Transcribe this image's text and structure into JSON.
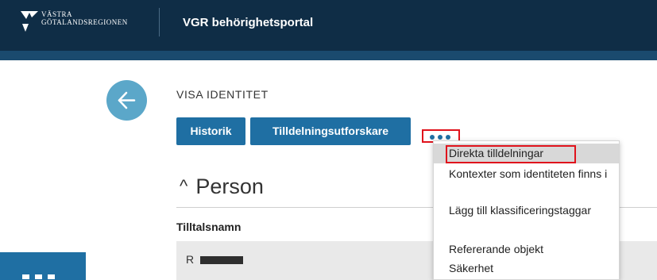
{
  "header": {
    "logo_line1": "VÄSTRA",
    "logo_line2": "GÖTALANDSREGIONEN",
    "app_title": "VGR behörighetsportal",
    "logo_icon": "vgr-logo-icon",
    "background": "#0f2d46"
  },
  "page": {
    "back_icon": "arrow-left-icon",
    "heading": "VISA IDENTITET",
    "buttons": {
      "historik": "Historik",
      "tilldelningsutforskare": "Tilldelningsutforskare"
    },
    "more_icon": "more-horizontal-icon",
    "accent": "#1f6fa3"
  },
  "section": {
    "chevron": "^",
    "title": "Person",
    "field_label": "Tilltalsnamn",
    "field_value_visible": "R"
  },
  "menu": {
    "items": [
      "Direkta tilldelningar",
      "Kontexter som identiteten finns i",
      "Lägg till klassificeringstaggar",
      "Refererande objekt",
      "Säkerhet"
    ],
    "highlight_color": "#e0131c"
  },
  "sidebar": {
    "tile_icon": "apps-grid-icon"
  }
}
